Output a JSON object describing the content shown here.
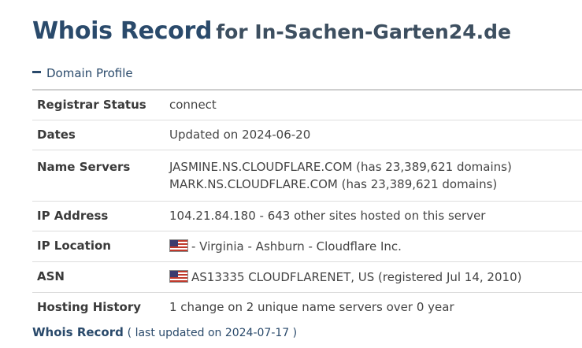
{
  "header": {
    "title": "Whois Record",
    "subtitle": "for In-Sachen-Garten24.de"
  },
  "profile": {
    "heading": "Domain Profile",
    "rows": {
      "registrar_status": {
        "label": "Registrar Status",
        "value": "connect"
      },
      "dates": {
        "label": "Dates",
        "value": "Updated on 2024-06-20"
      },
      "name_servers": {
        "label": "Name Servers",
        "ns1": "JASMINE.NS.CLOUDFLARE.COM (has 23,389,621 domains)",
        "ns2": "MARK.NS.CLOUDFLARE.COM (has 23,389,621 domains)"
      },
      "ip_address": {
        "label": "IP Address",
        "value": "104.21.84.180 - 643 other sites hosted on this server"
      },
      "ip_location": {
        "label": "IP Location",
        "value": "- Virginia - Ashburn - Cloudflare Inc.",
        "flag": "us-flag-icon"
      },
      "asn": {
        "label": "ASN",
        "value": "AS13335 CLOUDFLARENET, US (registered Jul 14, 2010)",
        "flag": "us-flag-icon"
      },
      "hosting_history": {
        "label": "Hosting History",
        "value": "1 change on 2 unique name servers over 0 year"
      }
    }
  },
  "footer": {
    "label": "Whois Record",
    "updated": "( last updated on 2024-07-17 )"
  },
  "colors": {
    "title": "#2a4a6b",
    "text": "#444444",
    "divider": "#dddddd"
  }
}
